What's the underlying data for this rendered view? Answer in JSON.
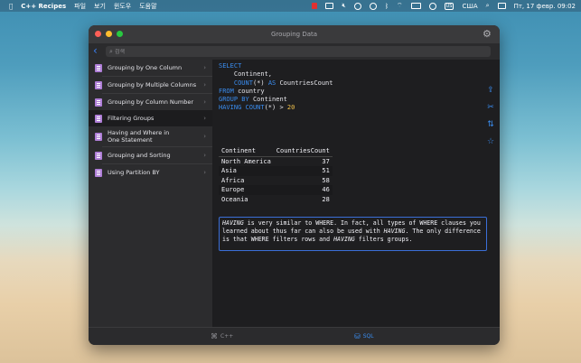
{
  "menubar": {
    "app_name": "C++ Recipes",
    "menus": [
      "파일",
      "보기",
      "윈도우",
      "도움말"
    ],
    "input_source": "США",
    "datetime": "Пт, 17 февр.  09:02"
  },
  "window": {
    "title": "Grouping Data"
  },
  "search": {
    "placeholder": "검색"
  },
  "sidebar": {
    "items": [
      {
        "label": "Grouping by One Column"
      },
      {
        "label": "Grouping by Multiple Columns"
      },
      {
        "label": "Grouping by Column Number"
      },
      {
        "label": "Filtering Groups"
      },
      {
        "label": "Having and Where in One Statement"
      },
      {
        "label": "Grouping and Sorting"
      },
      {
        "label": "Using Partition BY"
      }
    ],
    "selected": "Filtering Groups"
  },
  "sql": {
    "select": "SELECT",
    "col1": "Continent,",
    "count_fn": "COUNT",
    "count_arg": "(*)",
    "as_kw": "AS",
    "alias": "CountriesCount",
    "from_kw": "FROM",
    "table": "country",
    "group_kw": "GROUP BY",
    "group_col": "Continent",
    "having_kw": "HAVING",
    "having_fn": "COUNT",
    "having_arg": "(*)",
    "having_op": ">",
    "having_val": "20"
  },
  "result": {
    "headers": [
      "Continent",
      "CountriesCount"
    ],
    "rows": [
      [
        "North America",
        "37"
      ],
      [
        "Asia",
        "51"
      ],
      [
        "Africa",
        "58"
      ],
      [
        "Europe",
        "46"
      ],
      [
        "Oceania",
        "28"
      ]
    ]
  },
  "note": {
    "kw_having": "HAVING",
    "text1": " is very similar to WHERE. In fact, all types of WHERE clauses you learned about thus far can also be used with ",
    "kw_having2": "HAVING",
    "text2": ". The only difference is that WHERE filters rows and ",
    "kw_having3": "HAVING",
    "text3": " filters groups."
  },
  "tabs": {
    "cpp": "C++",
    "sql": "SQL",
    "active": "SQL"
  },
  "colors": {
    "accent": "#3a8df0",
    "sidebar_icon": "#b07fd8",
    "number": "#f0c14b"
  }
}
